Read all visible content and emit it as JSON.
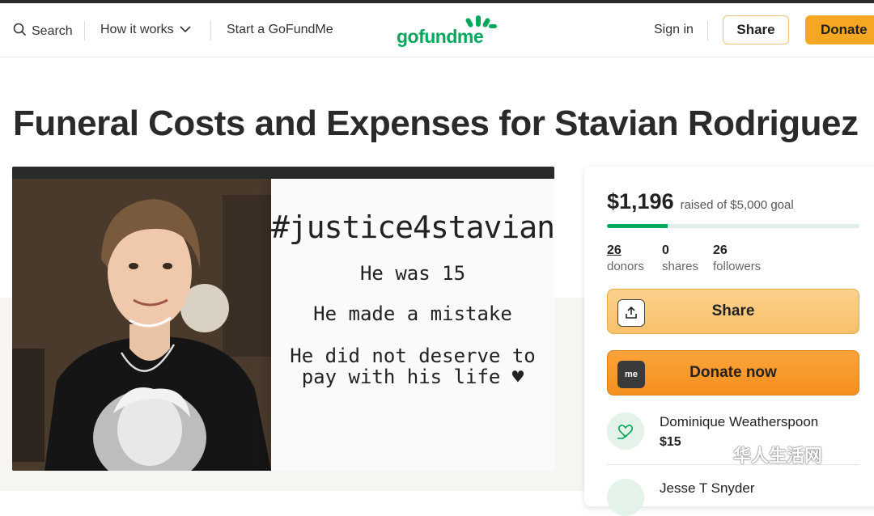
{
  "header": {
    "search_label": "Search",
    "how_it_works_label": "How it works",
    "start_label": "Start a GoFundMe",
    "logo_text": "gofundme",
    "sign_in_label": "Sign in",
    "share_label": "Share",
    "donate_label": "Donate"
  },
  "campaign": {
    "title": "Funeral Costs and Expenses for Stavian Rodriguez",
    "image_card": {
      "hashtag": "#justice4stavian",
      "line1": "He was 15",
      "line2": "He made a mistake",
      "line3": "He did not deserve to",
      "line4": "pay with his life ♥"
    }
  },
  "sidebar": {
    "raised_amount": "$1,196",
    "raised_of_goal": "raised of $5,000 goal",
    "progress": 0.2392,
    "stats": [
      {
        "value": "26",
        "label": "donors"
      },
      {
        "value": "0",
        "label": "shares"
      },
      {
        "value": "26",
        "label": "followers"
      }
    ],
    "share_button": "Share",
    "donate_button": "Donate now",
    "donate_icon_text": "me",
    "donors": [
      {
        "name": "Dominique Weatherspoon",
        "amount": "$15"
      },
      {
        "name": "Jesse T Snyder",
        "amount": ""
      }
    ]
  },
  "watermark": {
    "text": "华人生活网"
  },
  "colors": {
    "brand_green": "#02a95c",
    "donate_orange": "#f5a623",
    "accent_amber": "#f8c06a"
  }
}
